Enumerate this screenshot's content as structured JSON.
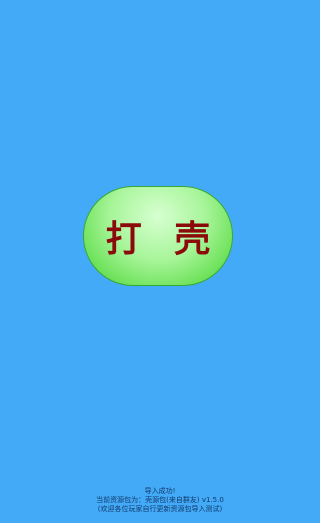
{
  "main_button": {
    "label": "打 壳"
  },
  "status": {
    "line1": "导入成功!",
    "line2": "当前资源包为：壳源包(来自群友) v1.5.0",
    "line3": "(欢迎各位玩家自行更新资源包导入测试)"
  }
}
